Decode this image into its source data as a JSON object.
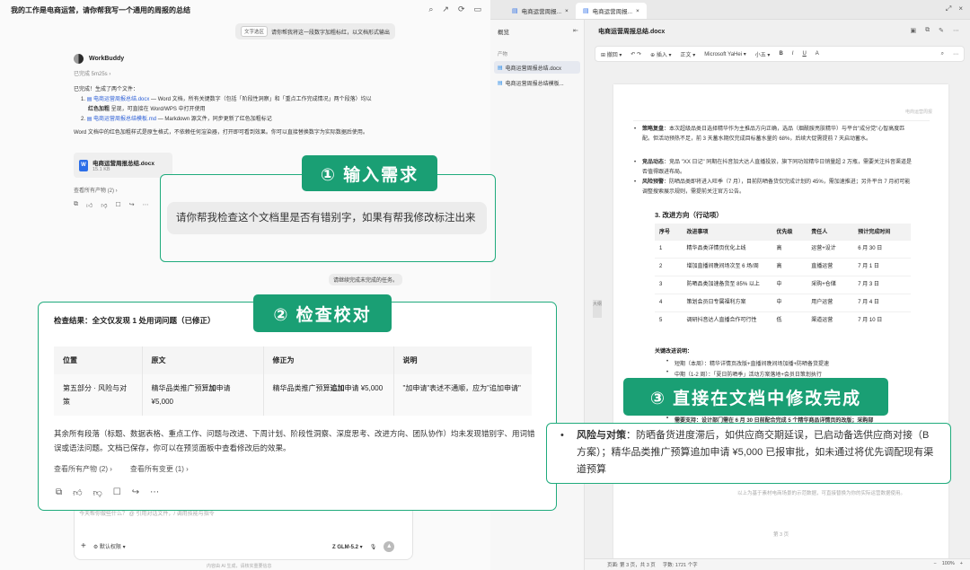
{
  "chat": {
    "title": "我的工作是电商运营，请你帮我写一个通用的周报的总结",
    "user_tag": "文字选区",
    "user_msg": "请你帮我将这一段数字加粗标红，以文档形式输出",
    "bot_name": "WorkBuddy",
    "elapsed": "已完成 5m25s",
    "done_line": "已完成！生成了两个文件：",
    "file1_num": "1.",
    "file1_name": "电商运营周报总结.docx",
    "file1_desc": " — Word 文档，所有关键数字（包括「阶段性洞察」和「重点工作完成情况」两个段落）均以",
    "file1_desc2_bold": "红色加粗",
    "file1_desc2": " 呈现，可直接在 Word/WPS 中打开使用",
    "file2_num": "2.",
    "file2_name": "电商运营周报总结模板.md",
    "file2_desc": " — Markdown 源文件，同步更新了红色加粗标记",
    "note": "Word 文档中的红色加粗样式是原生格式，不依赖任何渲染器，打开即可看到效果。你可以直接替换数字为实际数据后使用。",
    "card_name": "电商运营周报总结.docx",
    "card_size": "15.1 KB",
    "view_all_1": "查看所有产物 (2) ›",
    "question": "请你帮我检查这个文档里是否有错别字，如果有帮我修改标注出来",
    "small_msg": "请继续完成未完成的任务。",
    "result_title": "检查结果：全文仅发现 1 处用词问题（已修正）",
    "table_headers": [
      "位置",
      "原文",
      "修正为",
      "说明"
    ],
    "table_row": {
      "pos": "第五部分 · 风险与对策",
      "orig_a": "精华品类推广预算",
      "orig_b": "加",
      "orig_c": "申请 ¥5,000",
      "fix_a": "精华品类推广预算",
      "fix_b": "追加",
      "fix_c": "申请 ¥5,000",
      "note": "\"加申请\"表述不通顺，应为\"追加申请\""
    },
    "result_para": "其余所有段落（标题、数据表格、重点工作、问题与改进、下周计划、阶段性洞察、深度思考、改进方向、团队协作）均未发现错别字、用词错误或语法问题。文档已保存，你可以在预览面板中查看修改后的效果。",
    "link_products": "查看所有产物 (2) ›",
    "link_changes": "查看所有变更 (1) ›",
    "input_placeholder": "今天帮你做些什么？ @ 引用对话文件，/ 调用技能与指令",
    "permission": "默认权限",
    "model": "GLM-5.2",
    "disclaimer": "内容由 AI 生成，请核实重要信息"
  },
  "badges": {
    "step1": "① 输入需求",
    "step2": "② 检查校对",
    "step3": "③ 直接在文档中修改完成"
  },
  "right": {
    "tab1": "电商运营周报...",
    "tab2": "电商运营周报...",
    "sidebar_title": "概览",
    "sidebar_section": "产物",
    "sidebar_items": [
      "电商运营周报总结.docx",
      "电商运营周报总结模板..."
    ],
    "doc_title": "电商运营周报总结.docx",
    "toolbar": [
      "撤回",
      "插入",
      "正文",
      "Microsoft YaHei",
      "小五",
      "B",
      "I",
      "U",
      "A"
    ],
    "collapse_label": "大纲",
    "page_header": "电商运营周报",
    "bullets": [
      {
        "b": "策略复盘",
        "t": "：本次超级品类日选择精华作为主推品方向正确，选品（烟酰胺亮肤精华）与平台\"成分党\"心智高度匹配。但活动预热不足，前 3 天蓄水期仅完成目标蓄水量的 68%，后续大促需提前 7 天启动蓄水。"
      },
      {
        "b": "竞品动态",
        "t": "：竞品 \"XX 日记\" 同期在抖音加大达人直播投放，旗下同功效精华日销量超 2 万瓶，需要关注抖音渠道是否值得跟进布局。"
      },
      {
        "b": "风险预警",
        "t": "：防晒品类即将进入旺季（7 月），目前防晒备货仅完成计划的 45%，需加速推进；另外平台 7 月初可能调整搜索展示规则，需提前关注官方公告。"
      }
    ],
    "section3": "3. 改进方向（行动项）",
    "plan_headers": [
      "序号",
      "改进事项",
      "优先级",
      "责任人",
      "预计完成时间"
    ],
    "plan_rows": [
      [
        "1",
        "精华品类详情页优化上线",
        "高",
        "运营+设计",
        "6 月 30 日"
      ],
      [
        "2",
        "增加直播间晚间场次至 6 场/周",
        "高",
        "直播运营",
        "7 月 1 日"
      ],
      [
        "3",
        "防晒品类加速备货至 85% 以上",
        "中",
        "采购+仓储",
        "7 月 3 日"
      ],
      [
        "4",
        "策划会员日专属福利方案",
        "中",
        "用户运营",
        "7 月 4 日"
      ],
      [
        "5",
        "调研抖音达人直播合作可行性",
        "低",
        "渠道运营",
        "7 月 10 日"
      ]
    ],
    "key_label": "关键改进说明：",
    "key_items": [
      "短期（本周）：精华详情页改版+直播间晚间场加播+防晒备货提速",
      "中期（1-2 周）：「夏日防晒季」活动方案落地+会员日策划执行"
    ],
    "support": "需要支持：设计部门需在 6 月 30 日前配合完成 5 个精华商品详情页的改版；采购部",
    "risk_bold": "风险与对策",
    "risk_text": "：防晒备货进度滞后，如供应商交期延误，已启动备选供应商对接（B 方案）；精华品类推广预算追加申请 ¥5,000 已报审批，如未通过将优先调配现有渠道预算",
    "footnote": "以上为基于素材电商场景的示范数据，可直接替换为你的实际运营数据使用。",
    "page_num": "第 3 页",
    "status": [
      "页面: 第 3 页，共 3 页",
      "字数: 1721 个字"
    ],
    "zoom": "100%"
  }
}
